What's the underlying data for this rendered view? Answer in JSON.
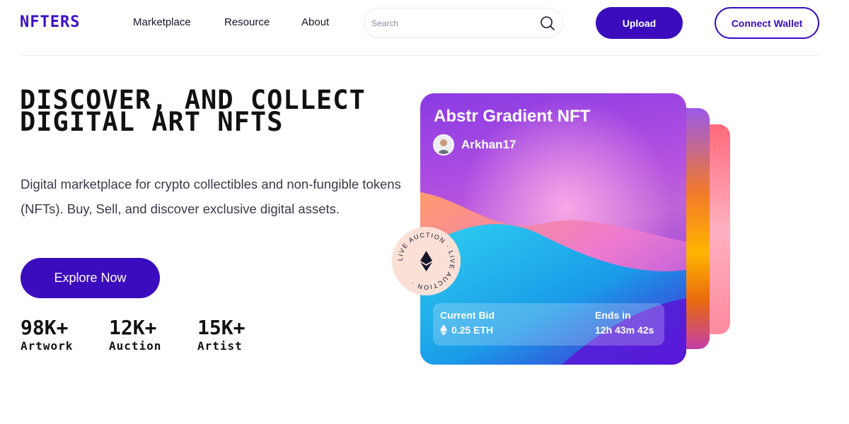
{
  "brand": {
    "logo": "NFTERS"
  },
  "nav": {
    "items": [
      "Marketplace",
      "Resource",
      "About"
    ]
  },
  "search": {
    "placeholder": "Search",
    "value": ""
  },
  "header": {
    "upload_label": "Upload",
    "wallet_label": "Connect Wallet"
  },
  "hero": {
    "title": "DISCOVER, AND COLLECT DIGITAL ART NFTS",
    "subtitle": "Digital marketplace for crypto collectibles and non-fungible tokens (NFTs). Buy, Sell, and discover exclusive digital assets.",
    "cta_label": "Explore Now",
    "stats": [
      {
        "value": "98K+",
        "label": "Artwork"
      },
      {
        "value": "12K+",
        "label": "Auction"
      },
      {
        "value": "15K+",
        "label": "Artist"
      }
    ]
  },
  "card": {
    "title": "Abstr Gradient NFT",
    "creator": "Arkhan17",
    "bid_label": "Current Bid",
    "bid_value": "0.25 ETH",
    "ends_label": "Ends in",
    "ends_value": "12h 43m 42s"
  },
  "badge": {
    "text": "LIVE AUCTION · LIVE AUCTION ·"
  },
  "colors": {
    "accent": "#3b0cbd",
    "badge_bg": "#fbe0d6"
  },
  "icons": [
    "search-icon",
    "ethereum-icon",
    "avatar"
  ]
}
